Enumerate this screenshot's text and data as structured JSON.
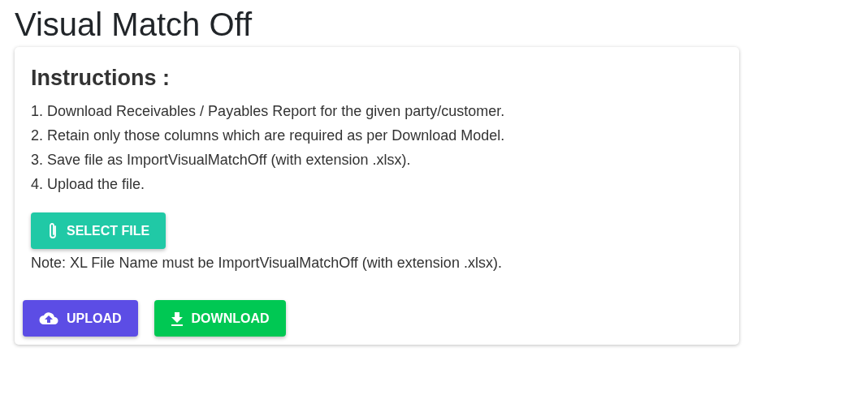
{
  "page_title": "Visual Match Off",
  "instructions": {
    "heading": "Instructions :",
    "steps": [
      "1. Download Receivables / Payables Report for the given party/customer.",
      "2. Retain only those columns which are required as per Download Model.",
      "3. Save file as ImportVisualMatchOff (with extension .xlsx).",
      "4. Upload the file."
    ]
  },
  "select_button": {
    "label": "SELECT FILE"
  },
  "note": "Note: XL File Name must be ImportVisualMatchOff (with extension .xlsx).",
  "actions": [
    {
      "kind": "upload",
      "label": "UPLOAD",
      "color": "#5c4de5"
    },
    {
      "kind": "download",
      "label": "DOWNLOAD",
      "color": "#00c853"
    }
  ]
}
